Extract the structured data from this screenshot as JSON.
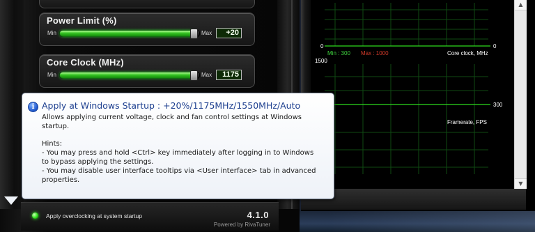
{
  "power_limit": {
    "title": "Power Limit (%)",
    "min_label": "Min",
    "max_label": "Max",
    "value": "+20",
    "slider_fraction": 0.96
  },
  "core_clock": {
    "title": "Core Clock (MHz)",
    "min_label": "Min",
    "max_label": "Max",
    "value": "1175",
    "slider_fraction": 0.96
  },
  "bottom_bar": {
    "startup_label": "Apply overclocking at system startup",
    "version": "4.1.0",
    "powered_by": "Powered by RivaTuner"
  },
  "monitor": {
    "graph1": {
      "top_left_value": "0",
      "top_right_value": "0",
      "min_text": "Min : 300",
      "max_text": "Max : 1000",
      "label": "Core clock, MHz",
      "bottom_left_value": "1500"
    },
    "graph2": {
      "right_value": "300",
      "label": "Framerate, FPS"
    },
    "scroll_up": "▲",
    "scroll_down": "▼"
  },
  "tooltip": {
    "icon": "i",
    "title": "Apply at Windows Startup : +20%/1175MHz/1550MHz/Auto",
    "line1": "Allows applying current voltage, clock and fan control settings at Windows",
    "line2": "startup.",
    "hints_heading": "Hints:",
    "hint1_line1": "- You may press and hold <Ctrl> key immediately after logging in to Windows",
    "hint1_line2": "to bypass applying the settings.",
    "hint2_line1": "- You may disable user interface tooltips via <User interface> tab in advanced",
    "hint2_line2": "properties."
  },
  "colors": {
    "accent_green": "#2edb1e",
    "tooltip_title": "#1d3f8f",
    "graph_grid": "#0f4a12",
    "min_text": "#3fd23f",
    "max_text": "#d23a2a"
  }
}
